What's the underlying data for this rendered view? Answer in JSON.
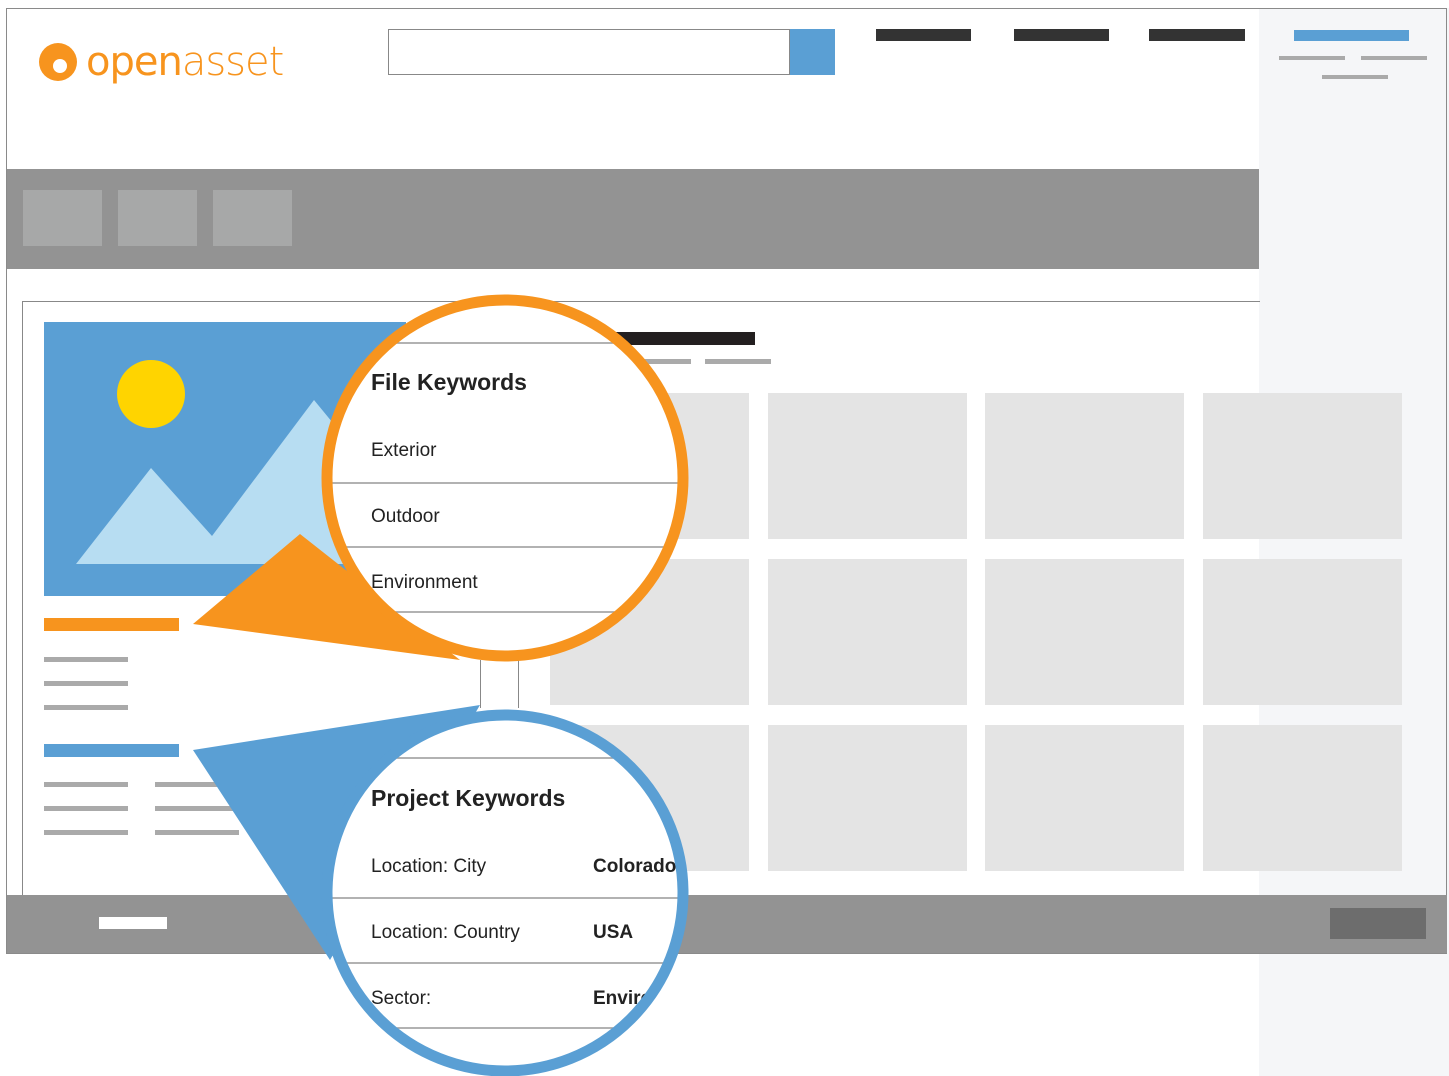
{
  "brand": {
    "logo_prefix": "open",
    "logo_suffix": "asset",
    "prefix_color": "#F7941E",
    "suffix_color": "#F7941E"
  },
  "colors": {
    "accent_orange": "#F7941E",
    "accent_blue": "#5A9FD4",
    "header_bar": "#939393",
    "toolbar_button": "#A7A8A8",
    "thumbnail": "#E4E4E4",
    "side_panel": "#F5F6F8",
    "sun": "#FFD400",
    "mountain": "#B7DDF2",
    "dark_line": "#333333"
  },
  "file_keywords": {
    "title": "File Keywords",
    "items": [
      "Exterior",
      "Outdoor",
      "Environment"
    ]
  },
  "project_keywords": {
    "title": "Project Keywords",
    "rows": [
      {
        "label": "Location: City",
        "value": "Colorado"
      },
      {
        "label": "Location: Country",
        "value": "USA"
      },
      {
        "label": "Sector:",
        "value": "Environment"
      }
    ]
  },
  "icons": [
    "logo-icon",
    "search-icon",
    "image-placeholder-icon",
    "sun-icon",
    "mountain-icon"
  ]
}
